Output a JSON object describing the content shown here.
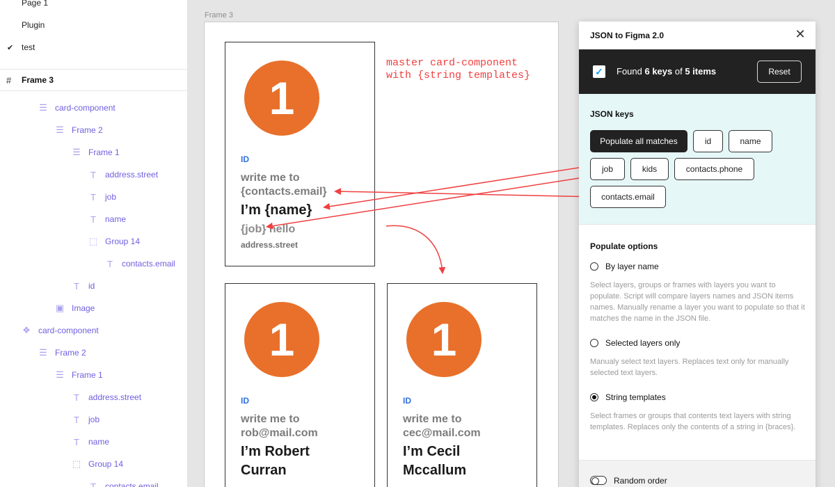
{
  "sidebar": {
    "pages": [
      {
        "label": "Page 1",
        "checked": false
      },
      {
        "label": "Plugin",
        "checked": false
      },
      {
        "label": "test",
        "checked": true
      }
    ],
    "frame_title": "Frame 3",
    "layers": [
      {
        "label": "card-component",
        "icon": "autolayout-icon"
      },
      {
        "label": "Frame 2",
        "icon": "autolayout-icon"
      },
      {
        "label": "Frame 1",
        "icon": "autolayout-icon"
      },
      {
        "label": "address.street",
        "icon": "text-icon"
      },
      {
        "label": "job",
        "icon": "text-icon"
      },
      {
        "label": "name",
        "icon": "text-icon"
      },
      {
        "label": "Group 14",
        "icon": "group-icon"
      },
      {
        "label": "contacts.email",
        "icon": "text-icon"
      },
      {
        "label": "id",
        "icon": "text-icon"
      },
      {
        "label": "Image",
        "icon": "image-icon"
      },
      {
        "label": "card-component",
        "icon": "component-icon"
      },
      {
        "label": "Frame 2",
        "icon": "autolayout-icon"
      },
      {
        "label": "Frame 1",
        "icon": "autolayout-icon"
      },
      {
        "label": "address.street",
        "icon": "text-icon"
      },
      {
        "label": "job",
        "icon": "text-icon"
      },
      {
        "label": "name",
        "icon": "text-icon"
      },
      {
        "label": "Group 14",
        "icon": "group-icon"
      },
      {
        "label": "contacts.email",
        "icon": "text-icon"
      }
    ]
  },
  "canvas": {
    "frame_label": "Frame 3",
    "annotation": "master card-component\nwith {string templates}",
    "cards": [
      {
        "badge": "1",
        "id": "ID",
        "write": "write me to\n{contacts.email}",
        "name": "I’m {name}",
        "job": "{job} hello",
        "street": "address.street"
      },
      {
        "badge": "1",
        "id": "ID",
        "write": "write me to\nrob@mail.com",
        "name": "I’m Robert\nCurran",
        "job": "",
        "street": ""
      },
      {
        "badge": "1",
        "id": "ID",
        "write": "write me to\ncec@mail.com",
        "name": "I’m Cecil\nMccallum",
        "job": "",
        "street": ""
      }
    ]
  },
  "plugin": {
    "title": "JSON to Figma 2.0",
    "found_prefix": "Found ",
    "found_keys": "6 keys",
    "found_mid": " of ",
    "found_items": "5 items",
    "reset_label": "Reset",
    "keys_title": "JSON keys",
    "chips": [
      "Populate all matches",
      "id",
      "name",
      "job",
      "kids",
      "contacts.phone",
      "contacts.email"
    ],
    "options_title": "Populate options",
    "options": [
      {
        "label": "By layer name",
        "selected": false,
        "desc": "Select layers, groups or frames with layers you want to populate. Script will compare layers names and JSON items names. Manually rename a layer you want to populate so that it matches the name in the JSON file."
      },
      {
        "label": "Selected layers only",
        "selected": false,
        "desc": "Manualy select text layers. Replaces text only for manually selected text layers."
      },
      {
        "label": "String templates",
        "selected": true,
        "desc": "Select frames or groups that contents text layers with string templates. Replaces only the contents of a string in {braces}."
      }
    ],
    "random_order_label": "Random order",
    "random_order_on": false
  },
  "colors": {
    "accent_red": "#f04040",
    "badge_orange": "#e8702b",
    "layer_purple": "#6f5fe0",
    "id_blue": "#2f6fe0"
  }
}
